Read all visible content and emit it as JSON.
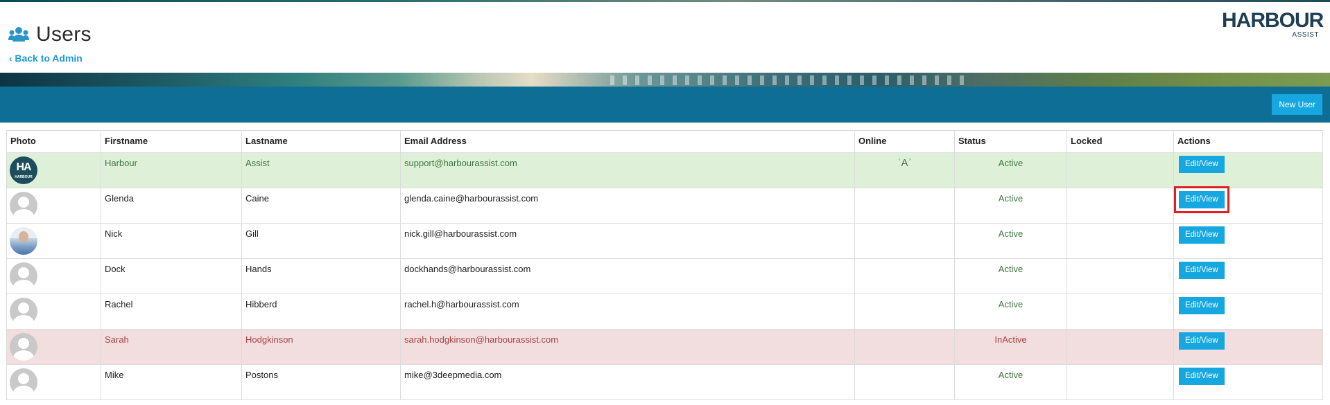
{
  "header": {
    "title": "Users",
    "back_label": "Back to Admin",
    "logo_main": "HARBOUR",
    "logo_sub": "ASSIST"
  },
  "toolbar": {
    "new_user_label": "New User"
  },
  "table": {
    "columns": [
      "Photo",
      "Firstname",
      "Lastname",
      "Email Address",
      "Online",
      "Status",
      "Locked",
      "Actions"
    ],
    "rows": [
      {
        "photo": "harbour-logo",
        "firstname": "Harbour",
        "lastname": "Assist",
        "email": "support@harbourassist.com",
        "online": "ʿAʾ",
        "status": "Active",
        "locked": "",
        "action": "Edit/View",
        "state": "success"
      },
      {
        "photo": "default",
        "firstname": "Glenda",
        "lastname": "Caine",
        "email": "glenda.caine@harbourassist.com",
        "online": "",
        "status": "Active",
        "locked": "",
        "action": "Edit/View",
        "state": "normal",
        "highlighted": true
      },
      {
        "photo": "person",
        "firstname": "Nick",
        "lastname": "Gill",
        "email": "nick.gill@harbourassist.com",
        "online": "",
        "status": "Active",
        "locked": "",
        "action": "Edit/View",
        "state": "normal"
      },
      {
        "photo": "default",
        "firstname": "Dock",
        "lastname": "Hands",
        "email": "dockhands@harbourassist.com",
        "online": "",
        "status": "Active",
        "locked": "",
        "action": "Edit/View",
        "state": "normal"
      },
      {
        "photo": "default",
        "firstname": "Rachel",
        "lastname": "Hibberd",
        "email": "rachel.h@harbourassist.com",
        "online": "",
        "status": "Active",
        "locked": "",
        "action": "Edit/View",
        "state": "normal"
      },
      {
        "photo": "default",
        "firstname": "Sarah",
        "lastname": "Hodgkinson",
        "email": "sarah.hodgkinson@harbourassist.com",
        "online": "",
        "status": "InActive",
        "locked": "",
        "action": "Edit/View",
        "state": "danger"
      },
      {
        "photo": "default",
        "firstname": "Mike",
        "lastname": "Postons",
        "email": "mike@3deepmedia.com",
        "online": "",
        "status": "Active",
        "locked": "",
        "action": "Edit/View",
        "state": "normal"
      }
    ]
  },
  "avatar_logo_text": {
    "main": "HA",
    "sub": "HARBOUR"
  },
  "colors": {
    "accent": "#16a7e0",
    "toolbar": "#0f6e96",
    "success_bg": "#dff0d8",
    "danger_bg": "#f2dede",
    "highlight": "#e02020"
  }
}
